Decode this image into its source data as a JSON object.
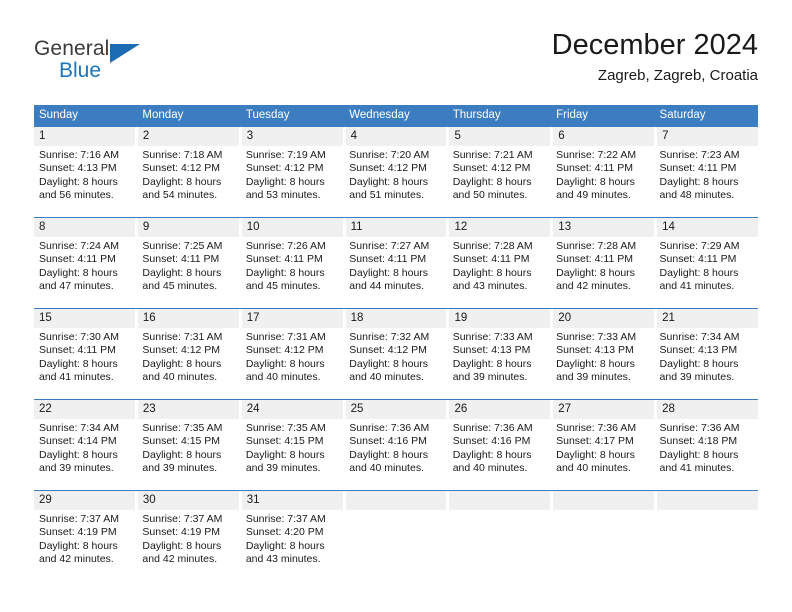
{
  "brand": {
    "name_part1": "General",
    "name_part2": "Blue",
    "accent_color": "#1b75bb",
    "triangle_icon": "triangle-icon"
  },
  "header": {
    "title": "December 2024",
    "subtitle": "Zagreb, Zagreb, Croatia"
  },
  "calendar": {
    "header_color": "#3b7dc0",
    "weekdays": [
      "Sunday",
      "Monday",
      "Tuesday",
      "Wednesday",
      "Thursday",
      "Friday",
      "Saturday"
    ],
    "weeks": [
      [
        {
          "day": "1",
          "sunrise": "Sunrise: 7:16 AM",
          "sunset": "Sunset: 4:13 PM",
          "daylight1": "Daylight: 8 hours",
          "daylight2": "and 56 minutes."
        },
        {
          "day": "2",
          "sunrise": "Sunrise: 7:18 AM",
          "sunset": "Sunset: 4:12 PM",
          "daylight1": "Daylight: 8 hours",
          "daylight2": "and 54 minutes."
        },
        {
          "day": "3",
          "sunrise": "Sunrise: 7:19 AM",
          "sunset": "Sunset: 4:12 PM",
          "daylight1": "Daylight: 8 hours",
          "daylight2": "and 53 minutes."
        },
        {
          "day": "4",
          "sunrise": "Sunrise: 7:20 AM",
          "sunset": "Sunset: 4:12 PM",
          "daylight1": "Daylight: 8 hours",
          "daylight2": "and 51 minutes."
        },
        {
          "day": "5",
          "sunrise": "Sunrise: 7:21 AM",
          "sunset": "Sunset: 4:12 PM",
          "daylight1": "Daylight: 8 hours",
          "daylight2": "and 50 minutes."
        },
        {
          "day": "6",
          "sunrise": "Sunrise: 7:22 AM",
          "sunset": "Sunset: 4:11 PM",
          "daylight1": "Daylight: 8 hours",
          "daylight2": "and 49 minutes."
        },
        {
          "day": "7",
          "sunrise": "Sunrise: 7:23 AM",
          "sunset": "Sunset: 4:11 PM",
          "daylight1": "Daylight: 8 hours",
          "daylight2": "and 48 minutes."
        }
      ],
      [
        {
          "day": "8",
          "sunrise": "Sunrise: 7:24 AM",
          "sunset": "Sunset: 4:11 PM",
          "daylight1": "Daylight: 8 hours",
          "daylight2": "and 47 minutes."
        },
        {
          "day": "9",
          "sunrise": "Sunrise: 7:25 AM",
          "sunset": "Sunset: 4:11 PM",
          "daylight1": "Daylight: 8 hours",
          "daylight2": "and 45 minutes."
        },
        {
          "day": "10",
          "sunrise": "Sunrise: 7:26 AM",
          "sunset": "Sunset: 4:11 PM",
          "daylight1": "Daylight: 8 hours",
          "daylight2": "and 45 minutes."
        },
        {
          "day": "11",
          "sunrise": "Sunrise: 7:27 AM",
          "sunset": "Sunset: 4:11 PM",
          "daylight1": "Daylight: 8 hours",
          "daylight2": "and 44 minutes."
        },
        {
          "day": "12",
          "sunrise": "Sunrise: 7:28 AM",
          "sunset": "Sunset: 4:11 PM",
          "daylight1": "Daylight: 8 hours",
          "daylight2": "and 43 minutes."
        },
        {
          "day": "13",
          "sunrise": "Sunrise: 7:28 AM",
          "sunset": "Sunset: 4:11 PM",
          "daylight1": "Daylight: 8 hours",
          "daylight2": "and 42 minutes."
        },
        {
          "day": "14",
          "sunrise": "Sunrise: 7:29 AM",
          "sunset": "Sunset: 4:11 PM",
          "daylight1": "Daylight: 8 hours",
          "daylight2": "and 41 minutes."
        }
      ],
      [
        {
          "day": "15",
          "sunrise": "Sunrise: 7:30 AM",
          "sunset": "Sunset: 4:11 PM",
          "daylight1": "Daylight: 8 hours",
          "daylight2": "and 41 minutes."
        },
        {
          "day": "16",
          "sunrise": "Sunrise: 7:31 AM",
          "sunset": "Sunset: 4:12 PM",
          "daylight1": "Daylight: 8 hours",
          "daylight2": "and 40 minutes."
        },
        {
          "day": "17",
          "sunrise": "Sunrise: 7:31 AM",
          "sunset": "Sunset: 4:12 PM",
          "daylight1": "Daylight: 8 hours",
          "daylight2": "and 40 minutes."
        },
        {
          "day": "18",
          "sunrise": "Sunrise: 7:32 AM",
          "sunset": "Sunset: 4:12 PM",
          "daylight1": "Daylight: 8 hours",
          "daylight2": "and 40 minutes."
        },
        {
          "day": "19",
          "sunrise": "Sunrise: 7:33 AM",
          "sunset": "Sunset: 4:13 PM",
          "daylight1": "Daylight: 8 hours",
          "daylight2": "and 39 minutes."
        },
        {
          "day": "20",
          "sunrise": "Sunrise: 7:33 AM",
          "sunset": "Sunset: 4:13 PM",
          "daylight1": "Daylight: 8 hours",
          "daylight2": "and 39 minutes."
        },
        {
          "day": "21",
          "sunrise": "Sunrise: 7:34 AM",
          "sunset": "Sunset: 4:13 PM",
          "daylight1": "Daylight: 8 hours",
          "daylight2": "and 39 minutes."
        }
      ],
      [
        {
          "day": "22",
          "sunrise": "Sunrise: 7:34 AM",
          "sunset": "Sunset: 4:14 PM",
          "daylight1": "Daylight: 8 hours",
          "daylight2": "and 39 minutes."
        },
        {
          "day": "23",
          "sunrise": "Sunrise: 7:35 AM",
          "sunset": "Sunset: 4:15 PM",
          "daylight1": "Daylight: 8 hours",
          "daylight2": "and 39 minutes."
        },
        {
          "day": "24",
          "sunrise": "Sunrise: 7:35 AM",
          "sunset": "Sunset: 4:15 PM",
          "daylight1": "Daylight: 8 hours",
          "daylight2": "and 39 minutes."
        },
        {
          "day": "25",
          "sunrise": "Sunrise: 7:36 AM",
          "sunset": "Sunset: 4:16 PM",
          "daylight1": "Daylight: 8 hours",
          "daylight2": "and 40 minutes."
        },
        {
          "day": "26",
          "sunrise": "Sunrise: 7:36 AM",
          "sunset": "Sunset: 4:16 PM",
          "daylight1": "Daylight: 8 hours",
          "daylight2": "and 40 minutes."
        },
        {
          "day": "27",
          "sunrise": "Sunrise: 7:36 AM",
          "sunset": "Sunset: 4:17 PM",
          "daylight1": "Daylight: 8 hours",
          "daylight2": "and 40 minutes."
        },
        {
          "day": "28",
          "sunrise": "Sunrise: 7:36 AM",
          "sunset": "Sunset: 4:18 PM",
          "daylight1": "Daylight: 8 hours",
          "daylight2": "and 41 minutes."
        }
      ],
      [
        {
          "day": "29",
          "sunrise": "Sunrise: 7:37 AM",
          "sunset": "Sunset: 4:19 PM",
          "daylight1": "Daylight: 8 hours",
          "daylight2": "and 42 minutes."
        },
        {
          "day": "30",
          "sunrise": "Sunrise: 7:37 AM",
          "sunset": "Sunset: 4:19 PM",
          "daylight1": "Daylight: 8 hours",
          "daylight2": "and 42 minutes."
        },
        {
          "day": "31",
          "sunrise": "Sunrise: 7:37 AM",
          "sunset": "Sunset: 4:20 PM",
          "daylight1": "Daylight: 8 hours",
          "daylight2": "and 43 minutes."
        },
        {
          "day": "",
          "sunrise": "",
          "sunset": "",
          "daylight1": "",
          "daylight2": ""
        },
        {
          "day": "",
          "sunrise": "",
          "sunset": "",
          "daylight1": "",
          "daylight2": ""
        },
        {
          "day": "",
          "sunrise": "",
          "sunset": "",
          "daylight1": "",
          "daylight2": ""
        },
        {
          "day": "",
          "sunrise": "",
          "sunset": "",
          "daylight1": "",
          "daylight2": ""
        }
      ]
    ]
  }
}
